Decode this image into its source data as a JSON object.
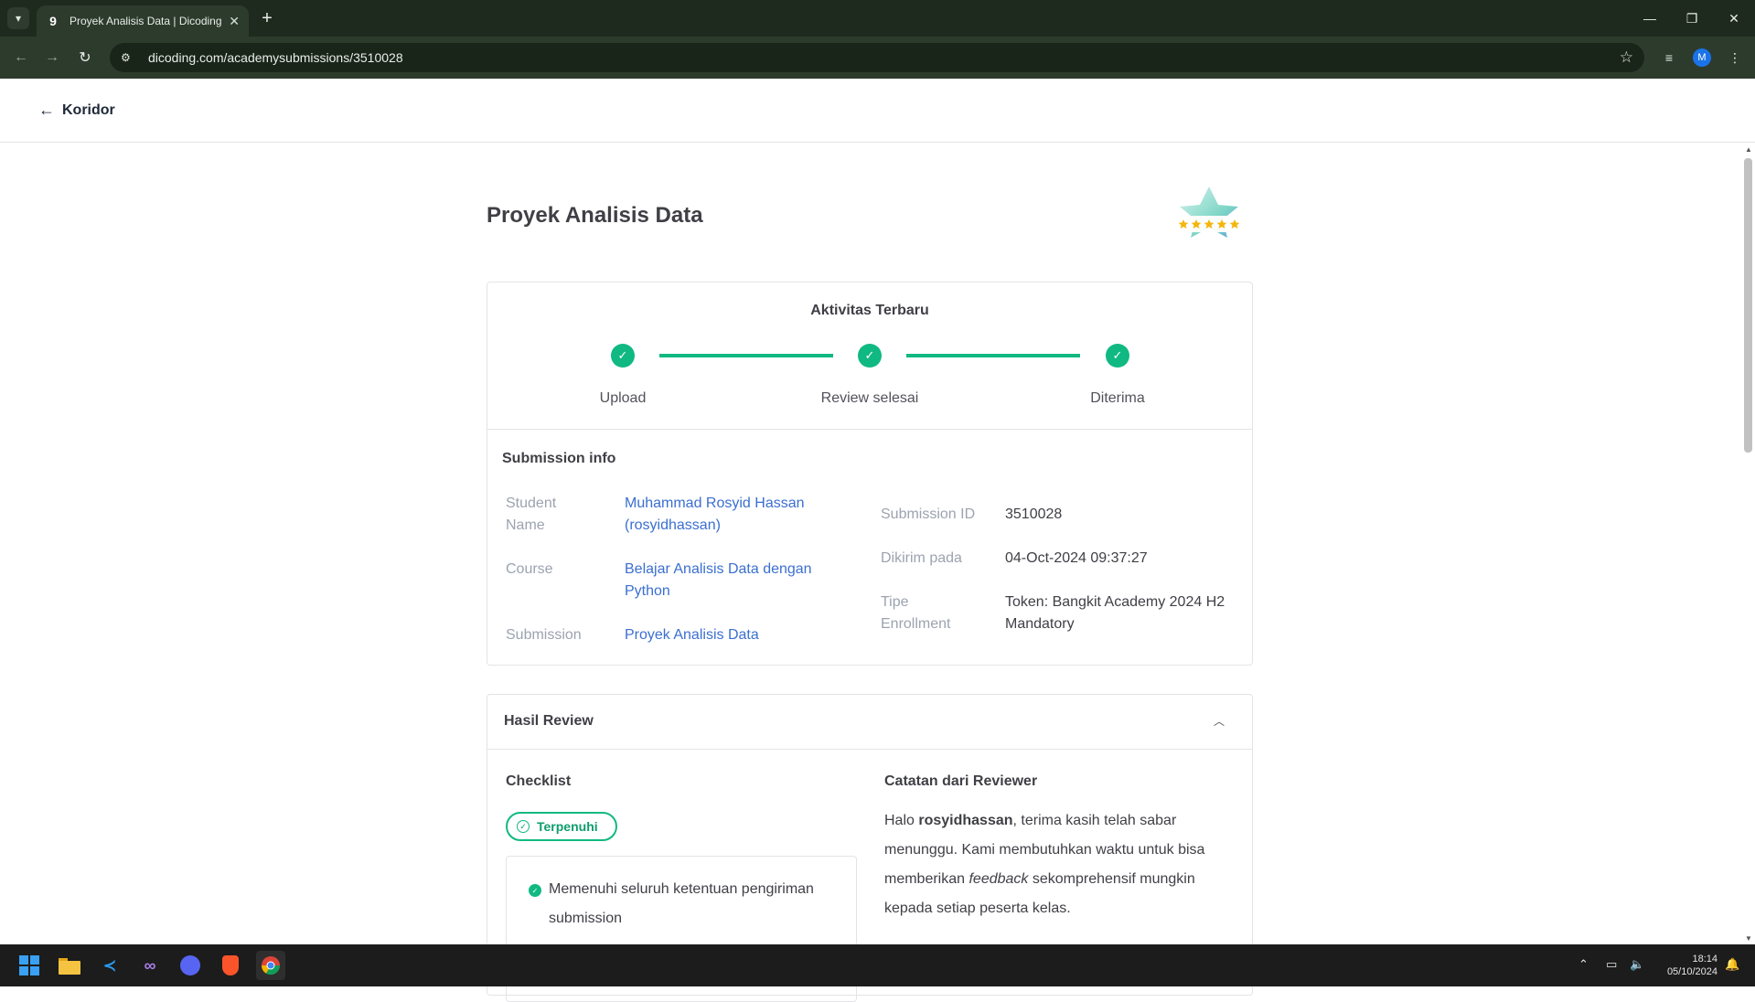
{
  "browser": {
    "tab_title": "Proyek Analisis Data | Dicoding",
    "url": "dicoding.com/academysubmissions/3510028",
    "profile_initial": "M"
  },
  "page": {
    "back_label": "Koridor",
    "title": "Proyek Analisis Data"
  },
  "activity": {
    "title": "Aktivitas Terbaru",
    "steps": [
      "Upload",
      "Review selesai",
      "Diterima"
    ]
  },
  "submission_info": {
    "title": "Submission info",
    "student_label": "Student Name",
    "student_value": "Muhammad Rosyid Hassan (rosyidhassan)",
    "course_label": "Course",
    "course_value": "Belajar Analisis Data dengan Python",
    "submission_label": "Submission",
    "submission_value": "Proyek Analisis Data",
    "id_label": "Submission ID",
    "id_value": "3510028",
    "sent_label": "Dikirim pada",
    "sent_value": "04-Oct-2024 09:37:27",
    "enroll_label": "Tipe Enrollment",
    "enroll_value": "Token: Bangkit Academy 2024 H2 Mandatory"
  },
  "review": {
    "title": "Hasil Review",
    "checklist_title": "Checklist",
    "status_pill": "Terpenuhi",
    "check_item": "Memenuhi seluruh ketentuan pengiriman submission",
    "notes_title": "Catatan dari Reviewer",
    "note_hello": "Halo ",
    "note_user": "rosyidhassan",
    "note_part1": ", terima kasih telah sabar menunggu. Kami membutuhkan waktu untuk bisa memberikan ",
    "note_feedback": "feedback",
    "note_part2": " sekomprehensif mungkin kepada setiap peserta kelas."
  },
  "taskbar": {
    "time": "18:14",
    "date": "05/10/2024"
  },
  "colors": {
    "accent_green": "#10b981",
    "link_blue": "#3b6fd0"
  }
}
